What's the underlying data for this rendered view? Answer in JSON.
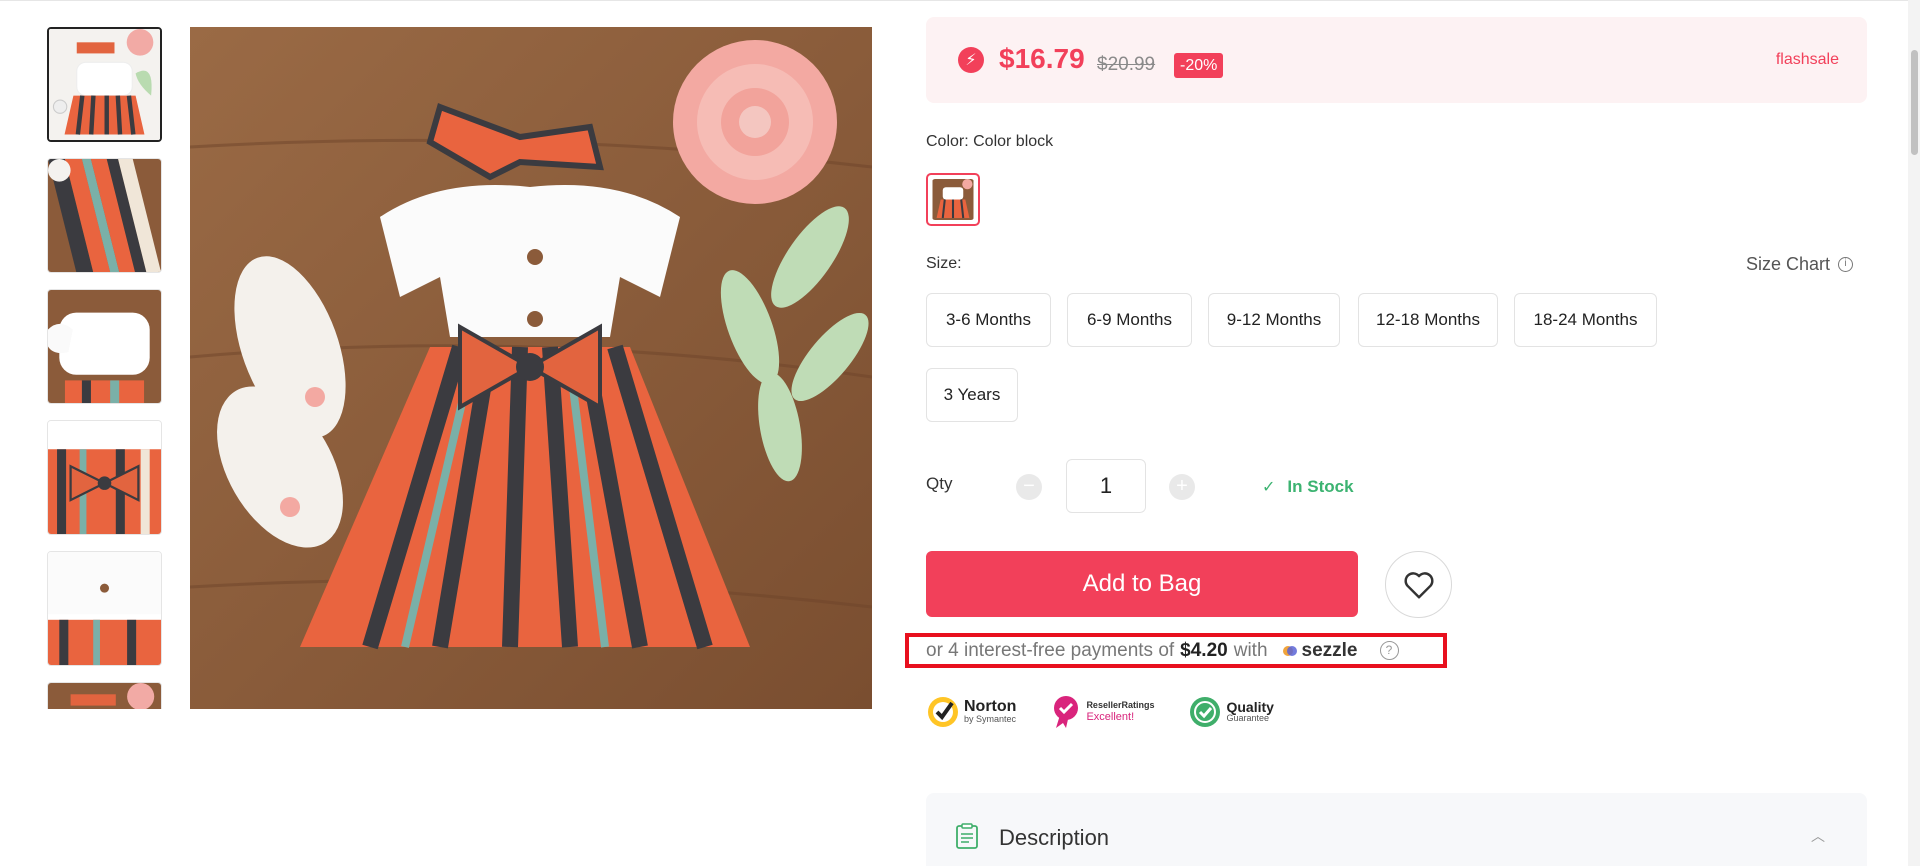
{
  "price_box": {
    "price": "$16.79",
    "original_price": "$20.99",
    "discount": "-20%",
    "flash_label": "flashsale"
  },
  "color": {
    "label": "Color: Color block"
  },
  "size": {
    "label": "Size:",
    "chart_label": "Size Chart",
    "options": [
      "3-6 Months",
      "6-9 Months",
      "9-12 Months",
      "12-18 Months",
      "18-24 Months",
      "3 Years"
    ]
  },
  "qty": {
    "label": "Qty",
    "value": "1",
    "minus": "−",
    "plus": "+",
    "stock": "In Stock"
  },
  "add_to_bag": "Add to Bag",
  "sezzle": {
    "prefix": "or 4 interest-free payments of",
    "amount": "$4.20",
    "with": "with",
    "brand": "sezzle",
    "help": "?"
  },
  "badges": {
    "norton_title": "Norton",
    "norton_sub": "by Symantec",
    "reseller_title": "ResellerRatings",
    "reseller_sub": "Excellent!",
    "quality_title": "Quality",
    "quality_sub": "Guarantee"
  },
  "description": {
    "title": "Description"
  },
  "colors": {
    "accent": "#f2405a",
    "stock_green": "#3cb371",
    "sezzle_border": "#e8101e"
  }
}
